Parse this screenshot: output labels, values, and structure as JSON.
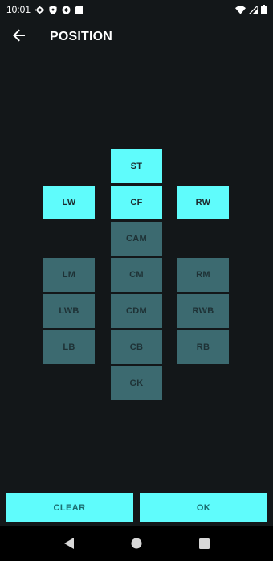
{
  "status_bar": {
    "time": "10:01",
    "left_icons": [
      "gear-icon",
      "shield-icon",
      "vpn-icon",
      "sd-card-icon"
    ],
    "right_icons": [
      "wifi-icon",
      "cellular-icon",
      "battery-icon"
    ]
  },
  "app_bar": {
    "title": "POSITION",
    "back_icon": "arrow-back-icon"
  },
  "colors": {
    "background": "#131719",
    "selected_tile": "#5ffcfc",
    "unselected_tile": "#3c6a70",
    "button": "#5ffcfc",
    "button_text": "#1b6d70"
  },
  "positions": {
    "st": {
      "label": "ST",
      "selected": true
    },
    "lw": {
      "label": "LW",
      "selected": true
    },
    "cf": {
      "label": "CF",
      "selected": true
    },
    "rw": {
      "label": "RW",
      "selected": true
    },
    "cam": {
      "label": "CAM",
      "selected": false
    },
    "lm": {
      "label": "LM",
      "selected": false
    },
    "cm": {
      "label": "CM",
      "selected": false
    },
    "rm": {
      "label": "RM",
      "selected": false
    },
    "lwb": {
      "label": "LWB",
      "selected": false
    },
    "cdm": {
      "label": "CDM",
      "selected": false
    },
    "rwb": {
      "label": "RWB",
      "selected": false
    },
    "lb": {
      "label": "LB",
      "selected": false
    },
    "cb": {
      "label": "CB",
      "selected": false
    },
    "rb": {
      "label": "RB",
      "selected": false
    },
    "gk": {
      "label": "GK",
      "selected": false
    }
  },
  "actions": {
    "clear_label": "CLEAR",
    "ok_label": "OK"
  },
  "nav_bar": {
    "icons": [
      "back-triangle-icon",
      "home-circle-icon",
      "recents-square-icon"
    ]
  }
}
